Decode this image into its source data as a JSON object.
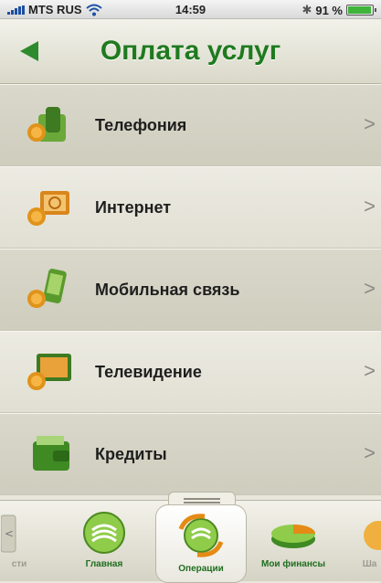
{
  "status_bar": {
    "carrier": "MTS RUS",
    "time": "14:59",
    "battery_text": "91 %",
    "battery_level": 0.91
  },
  "header": {
    "title": "Оплата услуг"
  },
  "menu": [
    {
      "label": "Телефония",
      "icon": "telephone-icon"
    },
    {
      "label": "Интернет",
      "icon": "internet-icon"
    },
    {
      "label": "Мобильная связь",
      "icon": "mobile-icon"
    },
    {
      "label": "Телевидение",
      "icon": "tv-icon"
    },
    {
      "label": "Кредиты",
      "icon": "wallet-icon"
    }
  ],
  "tabs": [
    {
      "label": "сти"
    },
    {
      "label": "Главная"
    },
    {
      "label": "Операции",
      "active": true
    },
    {
      "label": "Мои финансы"
    },
    {
      "label": "Ша"
    }
  ],
  "colors": {
    "accent": "#1f7a1f",
    "text": "#1e1e1e"
  }
}
